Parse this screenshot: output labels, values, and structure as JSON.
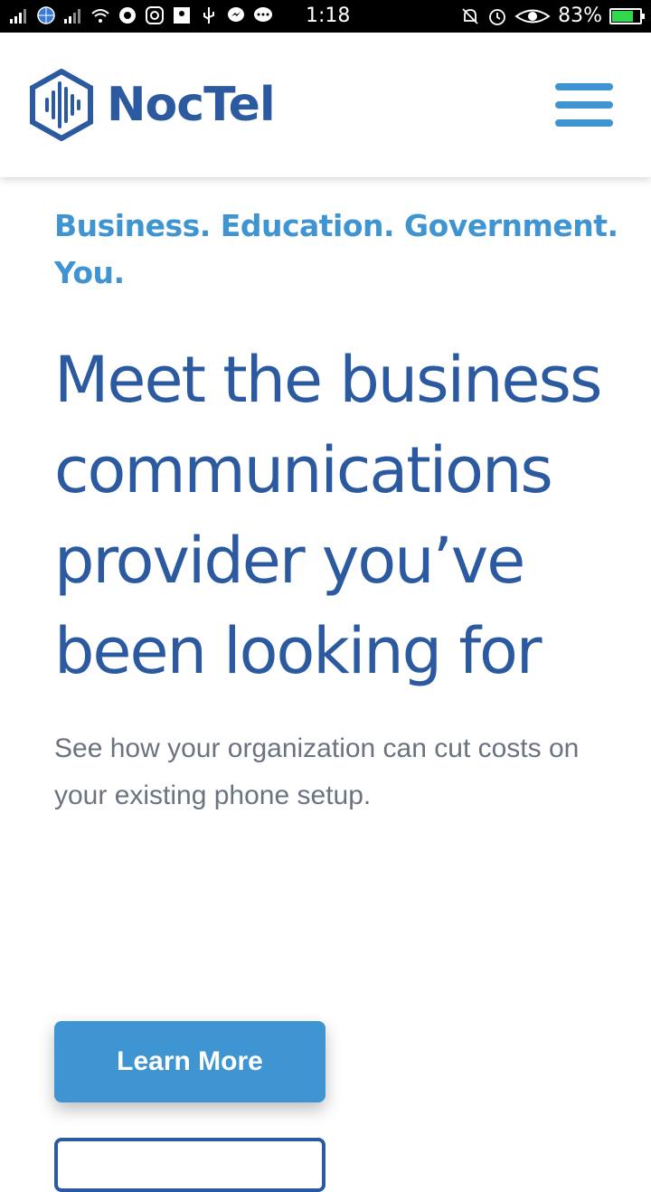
{
  "status_bar": {
    "time": "1:18",
    "battery_percent": "83%",
    "battery_level": 0.83,
    "left_icons": [
      "signal-icon",
      "globe-icon",
      "signal-icon",
      "wifi-icon",
      "chrome-icon",
      "instagram-icon",
      "image-icon",
      "usb-icon",
      "messenger-icon",
      "chat-icon"
    ],
    "right_icons": [
      "mute-icon",
      "alarm-icon",
      "eye-icon"
    ]
  },
  "header": {
    "logo_text": "NocTel",
    "menu_icon": "hamburger-menu-icon"
  },
  "hero": {
    "tagline": "Business. Education. Government. You.",
    "headline": "Meet the business communications provider you’ve been looking for",
    "subtext": "See how your organization can cut costs on your existing phone setup.",
    "primary_button_label": "Learn More",
    "secondary_button_label": ""
  },
  "colors": {
    "brand_dark": "#2c5aa0",
    "brand_light": "#3e95d1",
    "body_text": "#6b7280"
  }
}
